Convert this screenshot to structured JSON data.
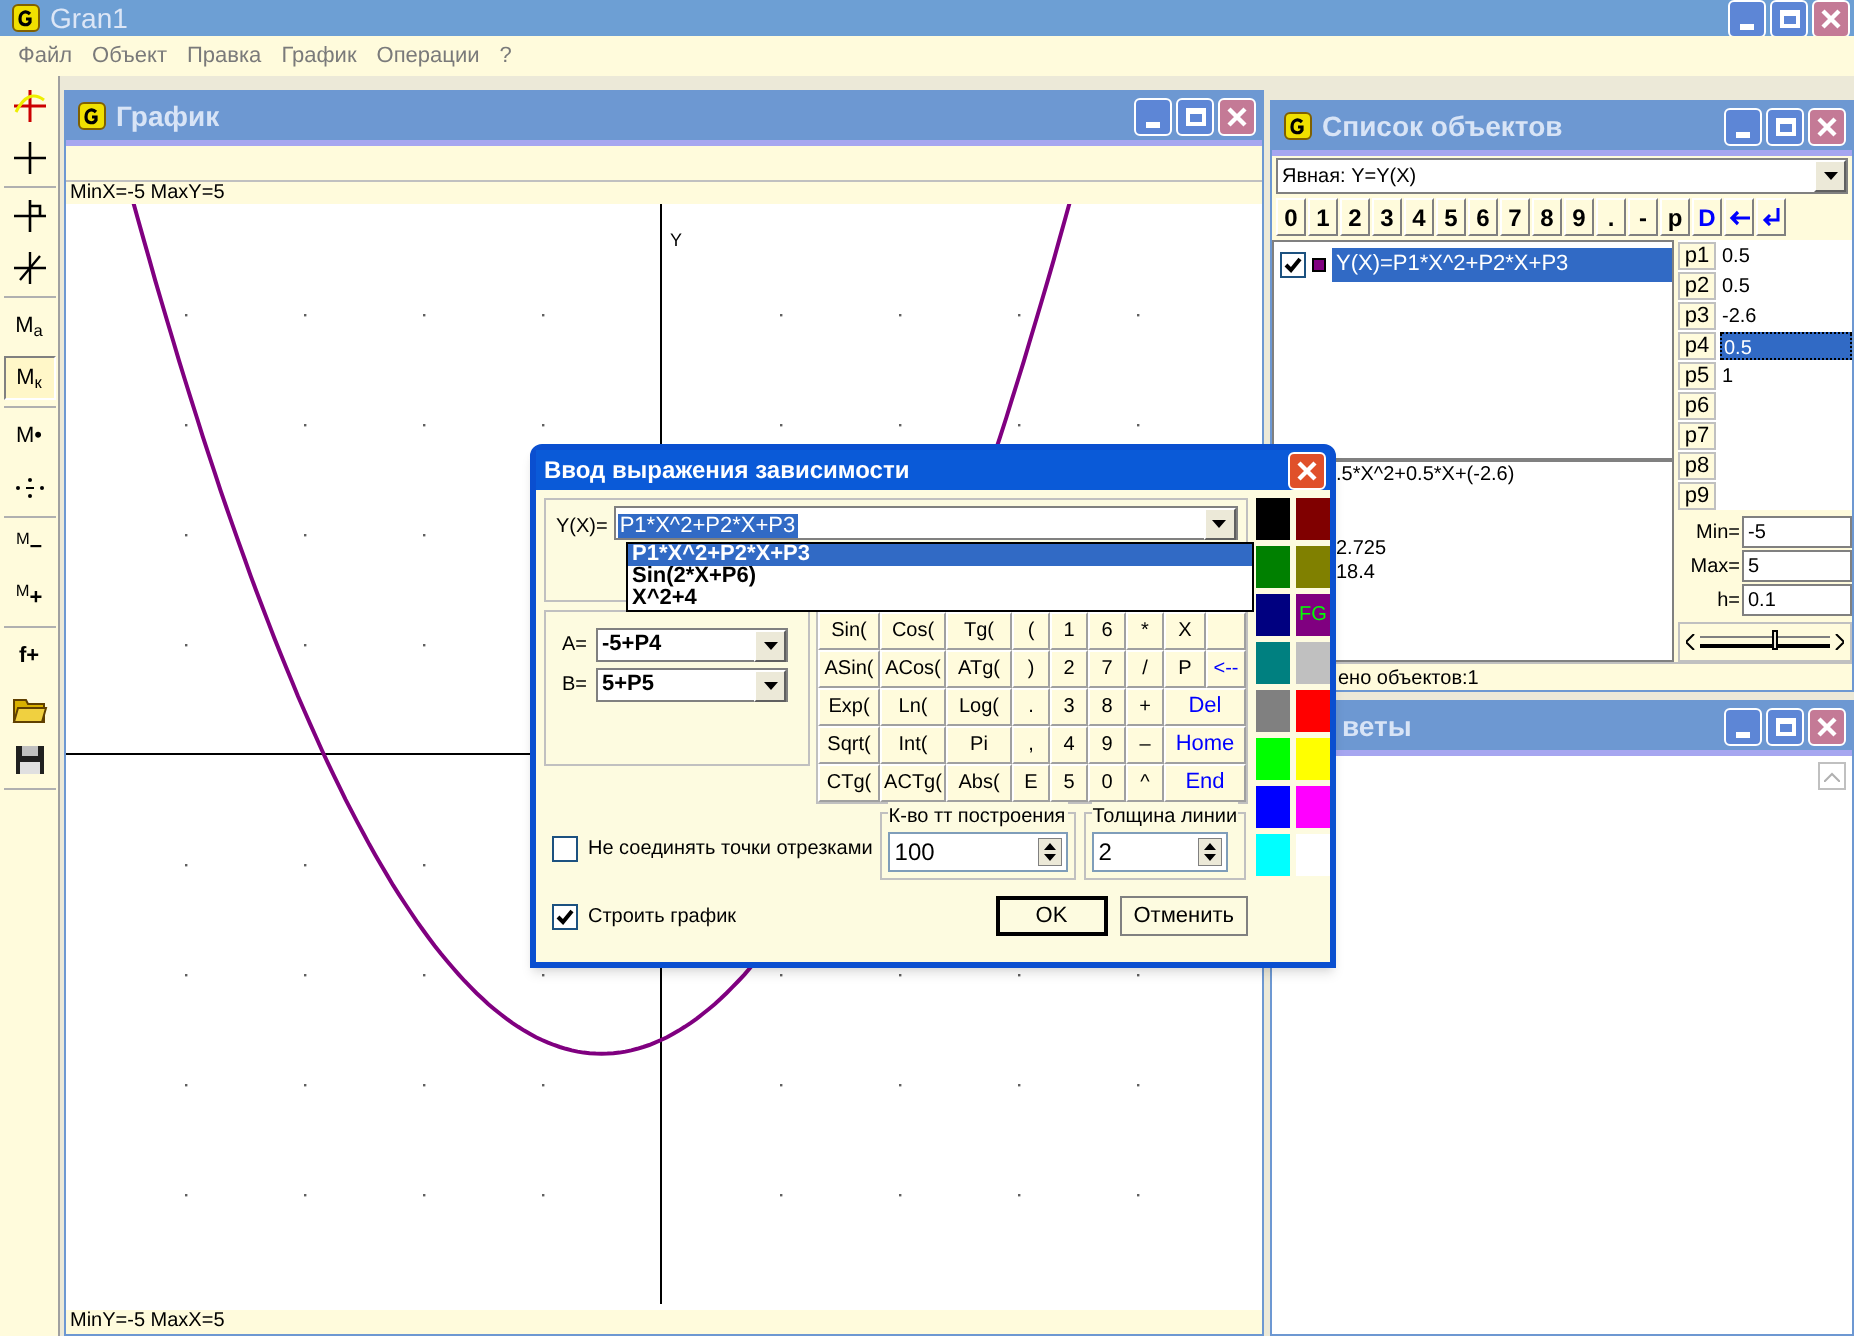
{
  "app": {
    "title": "Gran1"
  },
  "menu": [
    "Файл",
    "Объект",
    "Правка",
    "График",
    "Операции",
    "?"
  ],
  "toolbar_groups": [
    {
      "items": [
        {
          "kind": "axes",
          "pressed": false
        },
        {
          "kind": "cross",
          "pressed": false
        }
      ]
    },
    {
      "items": [
        {
          "kind": "pin",
          "pressed": false
        },
        {
          "kind": "slant",
          "pressed": false
        }
      ]
    },
    {
      "items": [
        {
          "kind": "label",
          "text": "M$_{a}$",
          "pressed": false
        },
        {
          "kind": "label",
          "text": "M$_{к}$",
          "pressed": true
        }
      ]
    },
    {
      "items": [
        {
          "kind": "label",
          "text": "M•",
          "pressed": false
        },
        {
          "kind": "dots",
          "pressed": false
        }
      ]
    },
    {
      "items": [
        {
          "kind": "label",
          "text": "$^{M}$**–**",
          "pressed": false
        },
        {
          "kind": "label",
          "text": "$^{M}$**+**",
          "pressed": false
        }
      ]
    },
    {
      "items": [
        {
          "kind": "label",
          "text": "**f+**",
          "pressed": false
        },
        {
          "kind": "folder",
          "pressed": false
        },
        {
          "kind": "save",
          "pressed": false
        }
      ]
    }
  ],
  "graph_window": {
    "title": "График",
    "header": "MinX=-5  MaxY=5",
    "axis_label": "Y",
    "footer": "MinY=-5  MaxX=5"
  },
  "objects_window": {
    "title": "Список объектов",
    "mode": "Явная: Y=Y(X)",
    "keys": [
      {
        "kind": "text",
        "text": "0",
        "color": "#000000"
      },
      {
        "kind": "text",
        "text": "1",
        "color": "#000000"
      },
      {
        "kind": "text",
        "text": "2",
        "color": "#000000"
      },
      {
        "kind": "text",
        "text": "3",
        "color": "#000000"
      },
      {
        "kind": "text",
        "text": "4",
        "color": "#000000"
      },
      {
        "kind": "text",
        "text": "5",
        "color": "#000000"
      },
      {
        "kind": "text",
        "text": "6",
        "color": "#000000"
      },
      {
        "kind": "text",
        "text": "7",
        "color": "#000000"
      },
      {
        "kind": "text",
        "text": "8",
        "color": "#000000"
      },
      {
        "kind": "text",
        "text": "9",
        "color": "#000000"
      },
      {
        "kind": "text",
        "text": ".",
        "color": "#000000"
      },
      {
        "kind": "text",
        "text": "-",
        "color": "#000000"
      },
      {
        "kind": "text",
        "text": "p",
        "color": "#000000"
      },
      {
        "kind": "text",
        "text": "D",
        "color": "#0000ff"
      },
      {
        "kind": "back"
      },
      {
        "kind": "enter"
      }
    ],
    "objects": [
      {
        "checked": true,
        "color": "#800080",
        "text": "Y(X)=P1*X^2+P2*X+P3",
        "selected": true
      }
    ],
    "params": [
      {
        "name": "p1",
        "value": "0.5",
        "selected": false
      },
      {
        "name": "p2",
        "value": "0.5",
        "selected": false
      },
      {
        "name": "p3",
        "value": "-2.6",
        "selected": false
      },
      {
        "name": "p4",
        "value": "0.5",
        "selected": true
      },
      {
        "name": "p5",
        "value": "1",
        "selected": false
      },
      {
        "name": "p6",
        "selected": false
      },
      {
        "name": "p7",
        "selected": false
      },
      {
        "name": "p8",
        "selected": false
      },
      {
        "name": "p9",
        "selected": false
      }
    ],
    "expression": ".5*X^2+0.5*X+(-2.6)",
    "values": [
      "2.725",
      "18.4"
    ],
    "range": [
      {
        "label": "Min=",
        "value": "-5"
      },
      {
        "label": "Max=",
        "value": "5"
      },
      {
        "label": "h=",
        "value": "0.1"
      }
    ],
    "slider": {
      "level": 0.55
    },
    "status": "ено объектов:1"
  },
  "colors_window": {
    "title": "веты"
  },
  "dialog": {
    "title": "Ввод выражения зависимости",
    "expr_label": "Y(X)=",
    "expr_value": "P1*X^2+P2*X+P3",
    "dropdown": [
      {
        "text": "P1*X^2+P2*X+P3",
        "selected": true
      },
      {
        "text": "Sin(2*X+P6)",
        "selected": false
      },
      {
        "text": "X^2+4",
        "selected": false
      }
    ],
    "bounds": [
      {
        "label": "A=",
        "value": "-5+P4"
      },
      {
        "label": "B=",
        "value": "5+P5"
      }
    ],
    "keypad": [
      {
        "kind": "key",
        "text": "Sin("
      },
      {
        "kind": "key",
        "text": "Cos("
      },
      {
        "kind": "key",
        "text": "Tg("
      },
      {
        "kind": "key",
        "text": "("
      },
      {
        "kind": "key",
        "text": "1"
      },
      {
        "kind": "key",
        "text": "6"
      },
      {
        "kind": "key",
        "text": "*"
      },
      {
        "kind": "key",
        "text": "X"
      },
      {
        "kind": "blank"
      },
      {
        "kind": "key",
        "text": "ASin("
      },
      {
        "kind": "key",
        "text": "ACos("
      },
      {
        "kind": "key",
        "text": "ATg("
      },
      {
        "kind": "key",
        "text": ")"
      },
      {
        "kind": "key",
        "text": "2"
      },
      {
        "kind": "key",
        "text": "7"
      },
      {
        "kind": "key",
        "text": "/"
      },
      {
        "kind": "key",
        "text": "P"
      },
      {
        "kind": "edit",
        "text": "<--"
      },
      {
        "kind": "key",
        "text": "Exp("
      },
      {
        "kind": "key",
        "text": "Ln("
      },
      {
        "kind": "key",
        "text": "Log("
      },
      {
        "kind": "key",
        "text": "."
      },
      {
        "kind": "key",
        "text": "3"
      },
      {
        "kind": "key",
        "text": "8"
      },
      {
        "kind": "key",
        "text": "+"
      },
      {
        "kind": "wide",
        "text": "Del"
      },
      {
        "kind": "key",
        "text": "Sqrt("
      },
      {
        "kind": "key",
        "text": "Int("
      },
      {
        "kind": "key",
        "text": "Pi"
      },
      {
        "kind": "key",
        "text": ","
      },
      {
        "kind": "key",
        "text": "4"
      },
      {
        "kind": "key",
        "text": "9"
      },
      {
        "kind": "key",
        "text": "–"
      },
      {
        "kind": "wide",
        "text": "Home"
      },
      {
        "kind": "key",
        "text": "CTg("
      },
      {
        "kind": "key",
        "text": "ACTg("
      },
      {
        "kind": "key",
        "text": "Abs("
      },
      {
        "kind": "key",
        "text": "E"
      },
      {
        "kind": "key",
        "text": "5"
      },
      {
        "kind": "key",
        "text": "0"
      },
      {
        "kind": "key",
        "text": "^"
      },
      {
        "kind": "wide",
        "text": "End"
      }
    ],
    "palette": [
      {
        "color": "#000000"
      },
      {
        "color": "#800000"
      },
      {
        "color": "#008000"
      },
      {
        "color": "#808000"
      },
      {
        "color": "#000080"
      },
      {
        "color": "#800080",
        "label": "FG"
      },
      {
        "color": "#008080"
      },
      {
        "color": "#c0c0c0"
      },
      {
        "color": "#808080"
      },
      {
        "color": "#ff0000"
      },
      {
        "color": "#00ff00"
      },
      {
        "color": "#ffff00"
      },
      {
        "color": "#0000ff"
      },
      {
        "color": "#ff00ff"
      },
      {
        "color": "#00ffff"
      },
      {
        "color": "#ffffff"
      }
    ],
    "connect_points": {
      "label": "Не соединять точки отрезками",
      "checked": false
    },
    "points": {
      "label": "К-во тт построения",
      "value": "100"
    },
    "line_width": {
      "label": "Толщина линии",
      "value": "2"
    },
    "draw_graph": {
      "label": "Строить график",
      "checked": true
    },
    "buttons": [
      {
        "text": "OK",
        "default": true
      },
      {
        "text": "Отменить",
        "default": false
      }
    ]
  }
}
